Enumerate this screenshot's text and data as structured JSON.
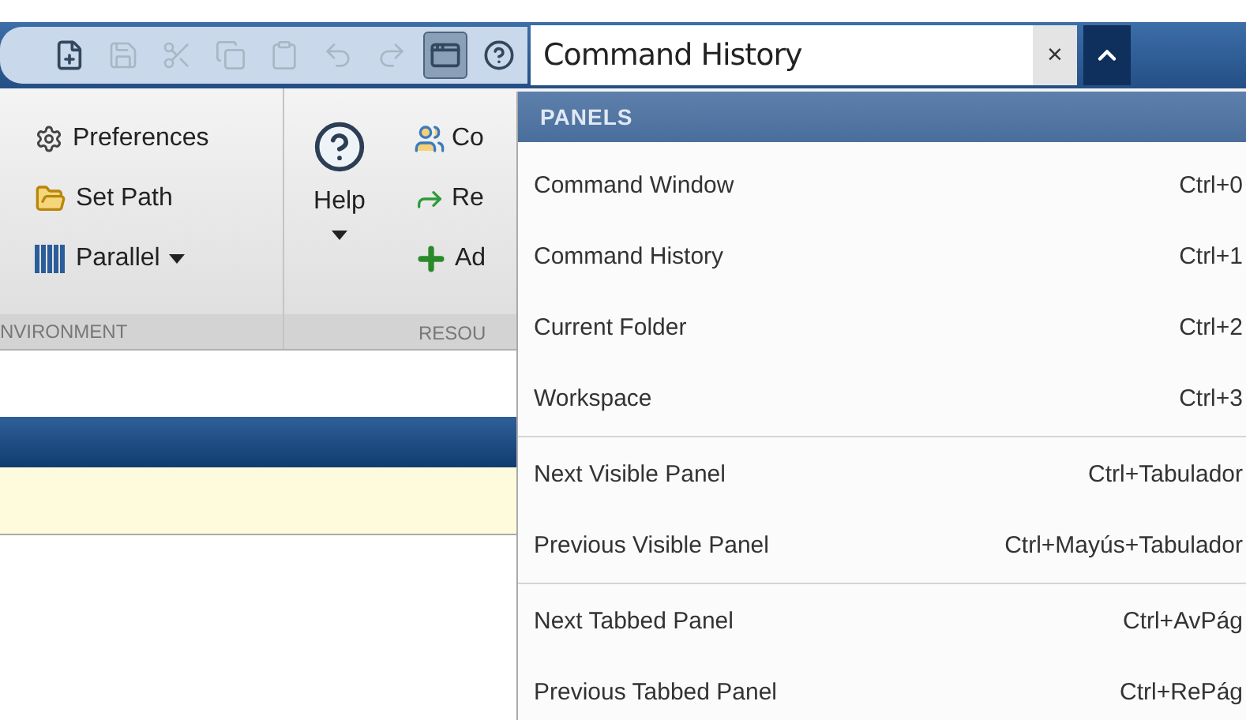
{
  "toolbar": {
    "buttons": [
      {
        "kind": "new",
        "disabled": false,
        "selected": false
      },
      {
        "kind": "save",
        "disabled": true,
        "selected": false
      },
      {
        "kind": "cut",
        "disabled": true,
        "selected": false
      },
      {
        "kind": "copy",
        "disabled": true,
        "selected": false
      },
      {
        "kind": "paste",
        "disabled": true,
        "selected": false
      },
      {
        "kind": "undo",
        "disabled": true,
        "selected": false
      },
      {
        "kind": "redo",
        "disabled": true,
        "selected": false
      },
      {
        "kind": "panels",
        "disabled": false,
        "selected": true
      },
      {
        "kind": "help",
        "disabled": false,
        "selected": false
      }
    ],
    "search": {
      "value": "Command History",
      "clear": "×"
    }
  },
  "ribbon": {
    "environment": {
      "items": [
        {
          "kind": "preferences",
          "label": "Preferences"
        },
        {
          "kind": "setpath",
          "label": "Set Path"
        },
        {
          "kind": "parallel",
          "label": "Parallel"
        }
      ],
      "label": "NVIRONMENT"
    },
    "help": {
      "label": "Help"
    },
    "resources": {
      "items": [
        {
          "kind": "community",
          "label": "Co"
        },
        {
          "kind": "request",
          "label": "Re"
        },
        {
          "kind": "addons",
          "label": "Ad"
        }
      ],
      "label": "RESOU"
    }
  },
  "menu": {
    "header": "PANELS",
    "groups": [
      [
        {
          "label": "Command Window",
          "shortcut": "Ctrl+0"
        },
        {
          "label": "Command History",
          "shortcut": "Ctrl+1"
        },
        {
          "label": "Current Folder",
          "shortcut": "Ctrl+2"
        },
        {
          "label": "Workspace",
          "shortcut": "Ctrl+3"
        }
      ],
      [
        {
          "label": "Next Visible Panel",
          "shortcut": "Ctrl+Tabulador"
        },
        {
          "label": "Previous Visible Panel",
          "shortcut": "Ctrl+Mayús+Tabulador"
        }
      ],
      [
        {
          "label": "Next Tabbed Panel",
          "shortcut": "Ctrl+AvPág"
        },
        {
          "label": "Previous Tabbed Panel",
          "shortcut": "Ctrl+RePág"
        }
      ]
    ]
  }
}
